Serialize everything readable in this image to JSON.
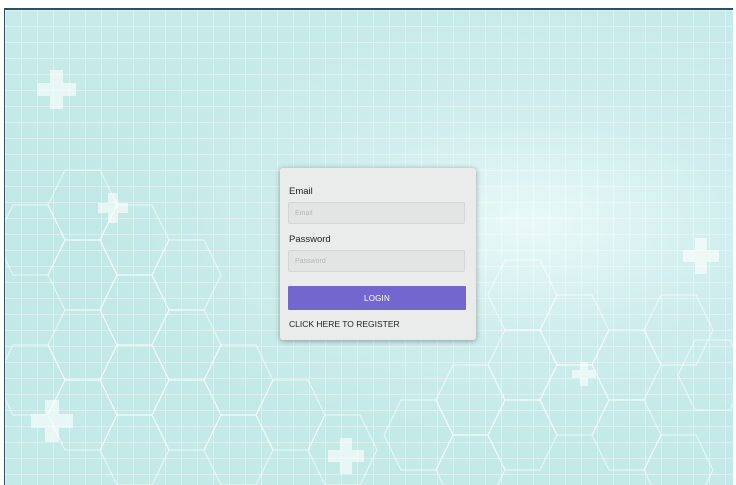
{
  "login_form": {
    "email_label": "Email",
    "email_placeholder": "Email",
    "password_label": "Password",
    "password_placeholder": "Password",
    "login_button": "LOGIN",
    "register_link": "CLICK HERE TO REGISTER"
  },
  "background": {
    "decorations": [
      "medical-cross-icon",
      "hexagon-pattern"
    ]
  },
  "colors": {
    "background": "#c4eae8",
    "card": "#e9eceb",
    "input": "#e2e5e4",
    "button": "#7466cf",
    "button_text": "#ffffff",
    "frame_border": "#2c4f63"
  }
}
